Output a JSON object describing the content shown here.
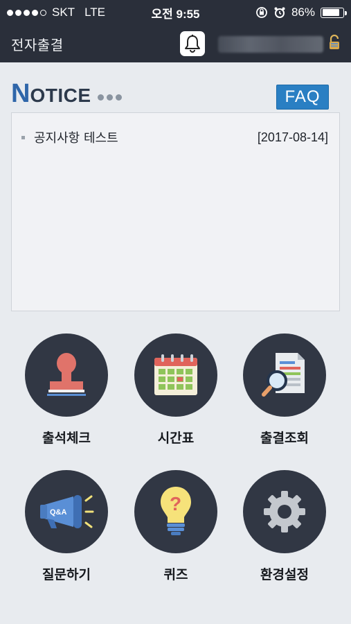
{
  "status": {
    "carrier": "SKT",
    "network": "LTE",
    "time": "오전 9:55",
    "battery_percent": "86%",
    "battery_level": 0.86
  },
  "header": {
    "title": "전자출결",
    "bell_icon": "bell-icon",
    "lock_icon": "lock-icon"
  },
  "notice": {
    "title_first": "N",
    "title_rest": "OTICE",
    "faq_label": "FAQ",
    "items": [
      {
        "text": "공지사항 테스트",
        "date": "[2017-08-14]"
      }
    ]
  },
  "menu": [
    {
      "label": "출석체크",
      "icon": "stamp-icon"
    },
    {
      "label": "시간표",
      "icon": "calendar-icon"
    },
    {
      "label": "출결조회",
      "icon": "document-search-icon"
    },
    {
      "label": "질문하기",
      "icon": "megaphone-qa-icon"
    },
    {
      "label": "퀴즈",
      "icon": "lightbulb-question-icon"
    },
    {
      "label": "환경설정",
      "icon": "gear-icon"
    }
  ],
  "colors": {
    "header_bg": "#2a2f3a",
    "accent": "#2a7fc3",
    "circle_bg": "#313744"
  }
}
